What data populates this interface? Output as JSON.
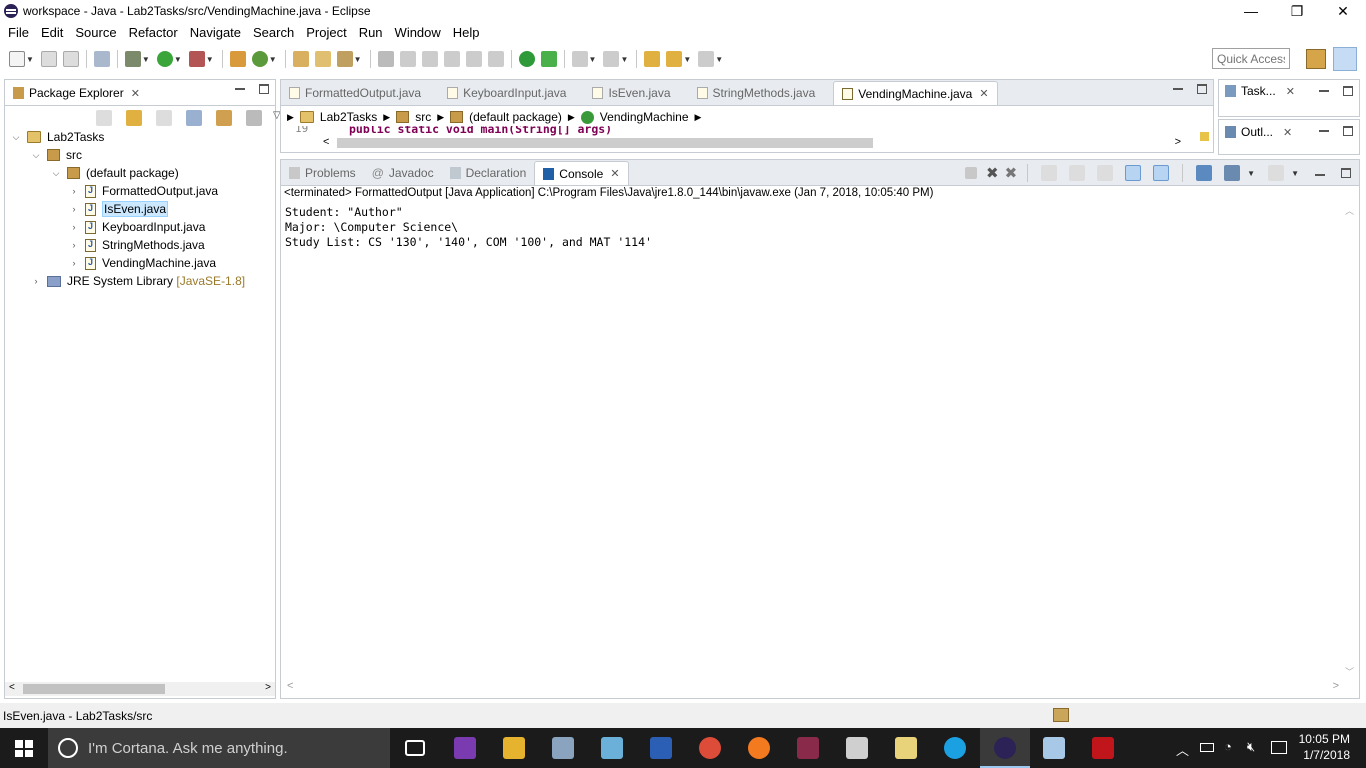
{
  "window": {
    "title": "workspace - Java - Lab2Tasks/src/VendingMachine.java - Eclipse"
  },
  "menu": [
    "File",
    "Edit",
    "Source",
    "Refactor",
    "Navigate",
    "Search",
    "Project",
    "Run",
    "Window",
    "Help"
  ],
  "quick_access": "Quick Access",
  "package_explorer": {
    "tab_label": "Package Explorer",
    "project": "Lab2Tasks",
    "src": "src",
    "package": "(default package)",
    "files": [
      "FormattedOutput.java",
      "IsEven.java",
      "KeyboardInput.java",
      "StringMethods.java",
      "VendingMachine.java"
    ],
    "selected_file": "IsEven.java",
    "library": "JRE System Library",
    "library_version": "[JavaSE-1.8]"
  },
  "editor": {
    "tabs": [
      "FormattedOutput.java",
      "KeyboardInput.java",
      "IsEven.java",
      "StringMethods.java",
      "VendingMachine.java"
    ],
    "active_tab": "VendingMachine.java",
    "breadcrumb": [
      "Lab2Tasks",
      "src",
      "(default package)",
      "VendingMachine"
    ],
    "code_line_fragment": "public static void main(String[] args)",
    "line_number": "19"
  },
  "side_views": {
    "tasks": "Task...",
    "outline": "Outl..."
  },
  "bottom_panel": {
    "tabs": [
      "Problems",
      "Javadoc",
      "Declaration",
      "Console"
    ],
    "active_tab": "Console",
    "console_header": "<terminated> FormattedOutput [Java Application] C:\\Program Files\\Java\\jre1.8.0_144\\bin\\javaw.exe (Jan 7, 2018, 10:05:40 PM)",
    "output": [
      "Student: \"Author\"",
      "Major: \\Computer Science\\",
      "Study List: CS '130', '140', COM '100', and MAT '114'"
    ]
  },
  "status_bar": {
    "text": "IsEven.java - Lab2Tasks/src"
  },
  "taskbar": {
    "search_placeholder": "I'm Cortana. Ask me anything.",
    "time": "10:05 PM",
    "date": "1/7/2018"
  }
}
